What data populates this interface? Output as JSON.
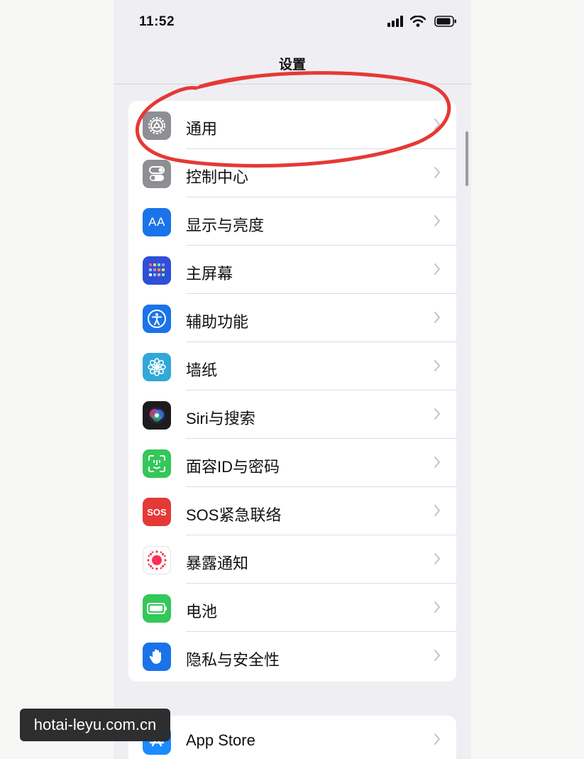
{
  "status_bar": {
    "time": "11:52"
  },
  "nav": {
    "title": "设置"
  },
  "settings": {
    "items": [
      {
        "label": "通用",
        "icon": "gear-icon",
        "color": "#8e8e93"
      },
      {
        "label": "控制中心",
        "icon": "toggles-icon",
        "color": "#8e8e93"
      },
      {
        "label": "显示与亮度",
        "icon": "text-size-icon",
        "color": "#1a73e8",
        "icon_text": "AA"
      },
      {
        "label": "主屏幕",
        "icon": "home-grid-icon",
        "color": "#2f4fd8"
      },
      {
        "label": "辅助功能",
        "icon": "accessibility-icon",
        "color": "#1a73e8"
      },
      {
        "label": "墙纸",
        "icon": "flower-icon",
        "color": "#30a8d8"
      },
      {
        "label": "Siri与搜索",
        "icon": "siri-icon",
        "color": "#1c1c1e"
      },
      {
        "label": "面容ID与密码",
        "icon": "face-id-icon",
        "color": "#34c759"
      },
      {
        "label": "SOS紧急联络",
        "icon": "sos-icon",
        "color": "#e53935",
        "icon_text": "SOS"
      },
      {
        "label": "暴露通知",
        "icon": "exposure-icon",
        "color": "#ffffff"
      },
      {
        "label": "电池",
        "icon": "battery-icon",
        "color": "#34c759"
      },
      {
        "label": "隐私与安全性",
        "icon": "hand-icon",
        "color": "#1a73e8"
      }
    ],
    "group2": [
      {
        "label": "App Store",
        "icon": "app-store-icon",
        "color": "#1a8cff"
      }
    ]
  },
  "annotation": {
    "color": "#e53935"
  },
  "watermark": {
    "text": "hotai-leyu.com.cn"
  }
}
